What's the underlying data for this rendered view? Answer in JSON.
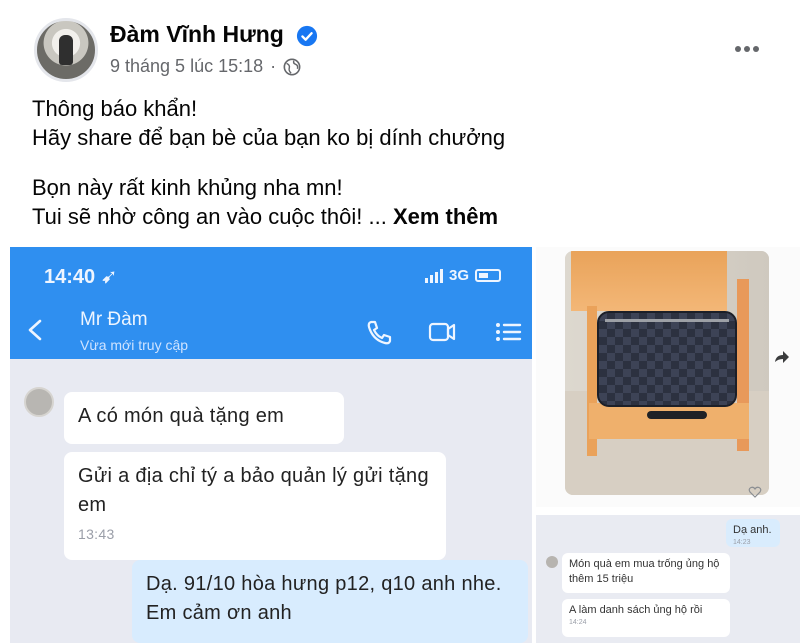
{
  "post": {
    "author": "Đàm Vĩnh Hưng",
    "timestamp": "9 tháng 5 lúc 15:18",
    "separator": "·",
    "text_line1": "Thông báo khẩn!",
    "text_line2": "Hãy share để bạn bè của bạn ko bị dính chưởng",
    "text_line3": "Bọn này rất kinh khủng nha mn!",
    "text_line4": "Tui sẽ nhờ công an vào cuộc thôi! ...",
    "see_more": "Xem thêm",
    "icons": [
      "verified-badge-icon",
      "globe-icon",
      "more-options-icon"
    ],
    "colors": {
      "verified": "#1877f2",
      "meta": "#65676b"
    }
  },
  "chat1": {
    "status_time": "14:40",
    "network": "3G",
    "contact_name": "Mr Đàm",
    "contact_status": "Vừa mới truy cập",
    "messages": [
      {
        "text": "A có món quà tặng em",
        "time": ""
      },
      {
        "text": "Gửi a địa chỉ tý a bảo quản lý gửi tặng em",
        "time": "13:43"
      },
      {
        "text": "Dạ. 91/10 hòa hưng p12, q10 anh nhe. Em cảm ơn anh",
        "time": ""
      }
    ],
    "header_color": "#2f8ff0",
    "icons": [
      "back-icon",
      "phone-icon",
      "video-call-icon",
      "menu-list-icon"
    ]
  },
  "chat2": {
    "messages": [
      {
        "text": "Dạ anh.",
        "time": "14:23"
      },
      {
        "text": "Món quà em mua trống ủng hộ thêm 15 triệu",
        "time": ""
      },
      {
        "text": "A làm danh sách ủng hộ rồi",
        "time": "14:24"
      }
    ]
  }
}
